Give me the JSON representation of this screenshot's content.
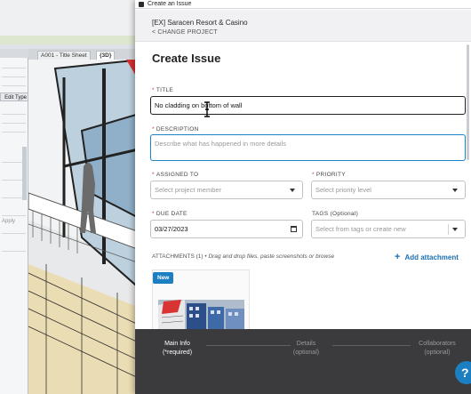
{
  "window": {
    "title": "Create an Issue"
  },
  "background_app": {
    "tabs": [
      "A001 - Title Sheet",
      "{3D}"
    ],
    "edit_type_label": "Edit Type",
    "apply_label": "Apply"
  },
  "project": {
    "name": "[EX] Saracen Resort & Casino",
    "change_label": "< CHANGE PROJECT"
  },
  "heading": "Create Issue",
  "form": {
    "title": {
      "label": "TITLE",
      "required": "*",
      "value": "No cladding on bottom of wall"
    },
    "description": {
      "label": "DESCRIPTION",
      "required": "*",
      "placeholder": "Describe what has happened in more details"
    },
    "assigned_to": {
      "label": "ASSIGNED TO",
      "required": "*",
      "placeholder": "Select project member"
    },
    "priority": {
      "label": "PRIORITY",
      "required": "*",
      "placeholder": "Select priority level"
    },
    "due_date": {
      "label": "DUE DATE",
      "required": "*",
      "value": "03/27/2023"
    },
    "tags": {
      "label": "TAGS (Optional)",
      "placeholder": "Select from tags or create new"
    }
  },
  "attachments": {
    "label": "ATTACHMENTS (1)",
    "separator": "•",
    "hint": "Drag and drop files, paste screenshots or browse",
    "add_label": "Add attachment",
    "add_icon": "+",
    "badge": "New"
  },
  "steps": [
    {
      "label": "Main Info\n(*required)",
      "state": "active"
    },
    {
      "label": "Details\n(optional)",
      "state": "inactive"
    },
    {
      "label": "Collaborators\n(optional)",
      "state": "inactive"
    }
  ],
  "help_label": "?",
  "colors": {
    "accent": "#1b7fc2",
    "required": "#d23b3b",
    "footer": "#3b3b3d"
  }
}
